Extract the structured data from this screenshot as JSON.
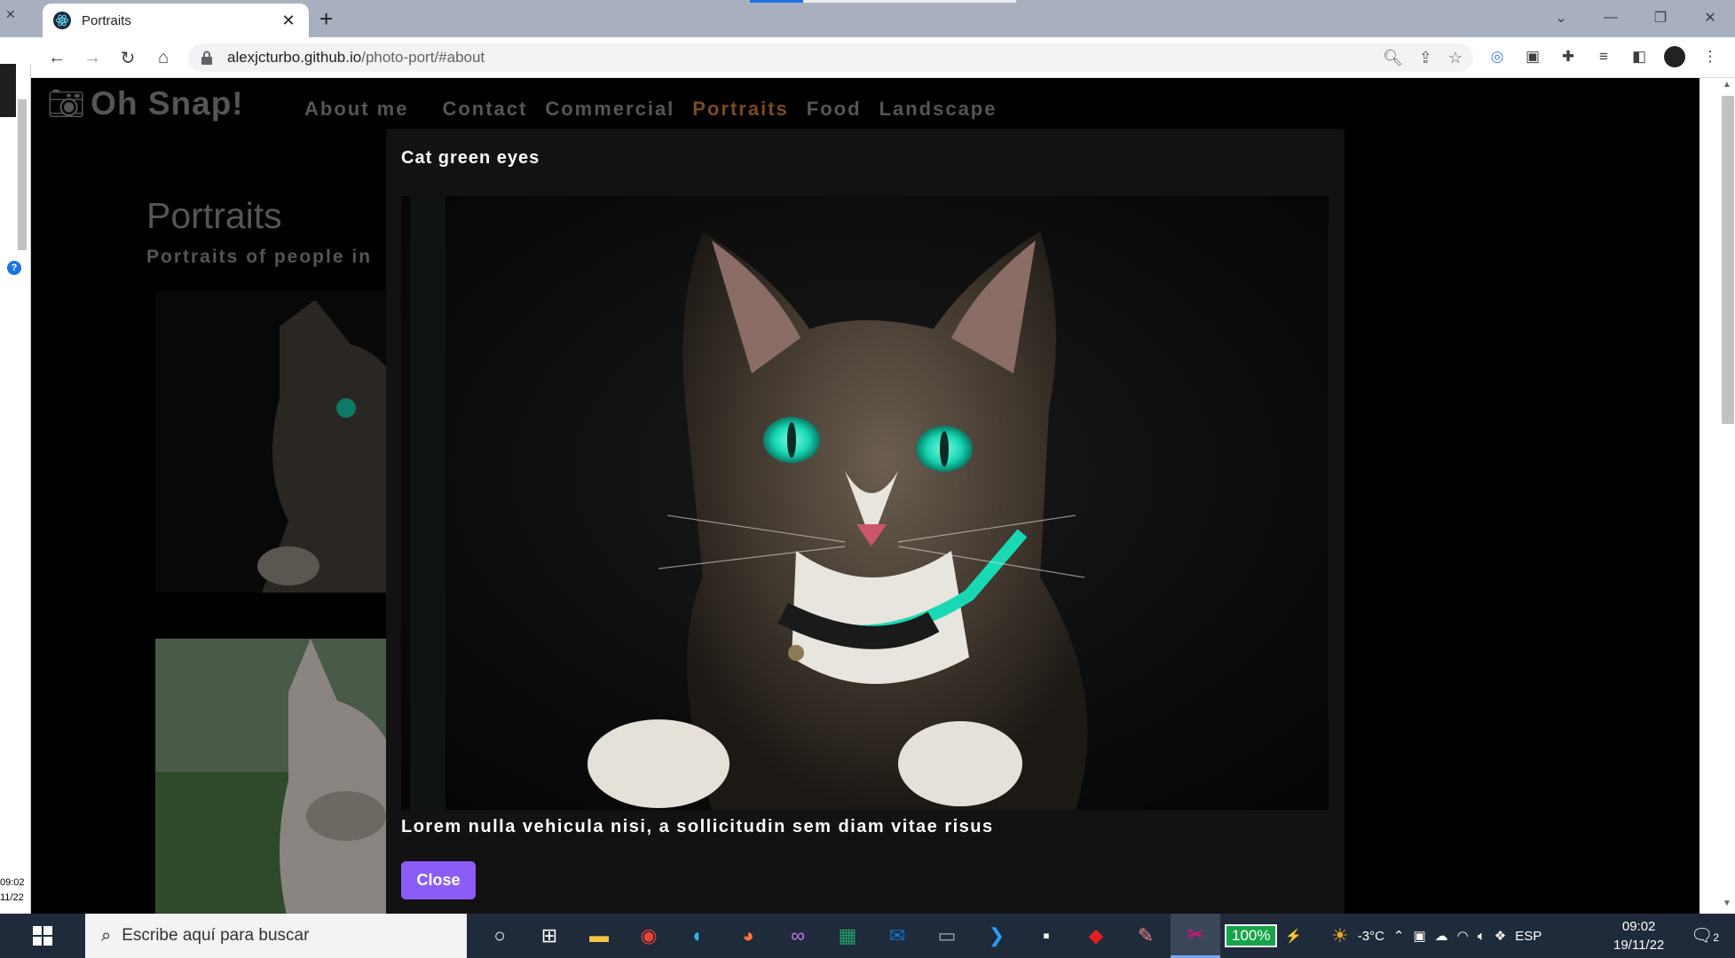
{
  "browser": {
    "tab_title": "Portraits",
    "url_host": "alexjcturbo.github.io",
    "url_path": "/photo-port/#about"
  },
  "site": {
    "brand": "Oh Snap!",
    "nav": [
      "About me",
      "Contact",
      "Commercial",
      "Portraits",
      "Food",
      "Landscape"
    ],
    "active_nav": "Portraits",
    "section_title": "Portraits",
    "section_subtitle": "Portraits of people in"
  },
  "modal": {
    "title": "Cat green eyes",
    "description": "Lorem nulla vehicula nisi, a sollicitudin sem diam vitae risus",
    "close_label": "Close"
  },
  "taskbar": {
    "search_placeholder": "Escribe aquí para buscar",
    "battery": "100%",
    "temperature": "-3°C",
    "language": "ESP",
    "time": "09:02",
    "date": "19/11/22",
    "notifications": "2"
  },
  "side_window": {
    "time": "09:02",
    "date": "11/22"
  },
  "colors": {
    "modal_bg": "#121212",
    "close_button": "#8b5cf6",
    "active_nav": "#7a4a22",
    "cat_eyes": "#19d9b4"
  }
}
